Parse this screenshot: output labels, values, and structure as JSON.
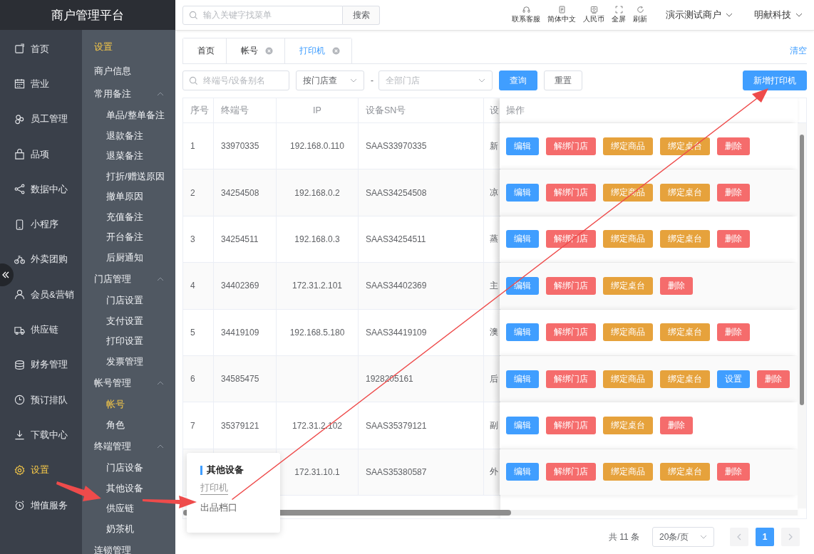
{
  "app_title": "商户管理平台",
  "nav": [
    {
      "label": "首页",
      "selected": false
    },
    {
      "label": "营业",
      "selected": false
    },
    {
      "label": "员工管理",
      "selected": false
    },
    {
      "label": "品项",
      "selected": false
    },
    {
      "label": "数据中心",
      "selected": false
    },
    {
      "label": "小程序",
      "selected": false
    },
    {
      "label": "外卖团购",
      "selected": false
    },
    {
      "label": "会员&营销",
      "selected": false
    },
    {
      "label": "供应链",
      "selected": false
    },
    {
      "label": "财务管理",
      "selected": false
    },
    {
      "label": "预订排队",
      "selected": false
    },
    {
      "label": "下载中心",
      "selected": false
    },
    {
      "label": "设置",
      "selected": true
    },
    {
      "label": "增值服务",
      "selected": false
    }
  ],
  "submenu": {
    "title": "设置",
    "items": [
      {
        "kind": "link",
        "label": "商户信息",
        "selected": false
      },
      {
        "kind": "group",
        "label": "常用备注",
        "expanded": true,
        "children": [
          {
            "label": "单品/整单备注",
            "selected": false
          },
          {
            "label": "退款备注",
            "selected": false
          },
          {
            "label": "退菜备注",
            "selected": false
          },
          {
            "label": "打折/赠送原因",
            "selected": false
          },
          {
            "label": "撤单原因",
            "selected": false
          },
          {
            "label": "充值备注",
            "selected": false
          },
          {
            "label": "开台备注",
            "selected": false
          },
          {
            "label": "后厨通知",
            "selected": false
          }
        ]
      },
      {
        "kind": "group",
        "label": "门店管理",
        "expanded": true,
        "children": [
          {
            "label": "门店设置",
            "selected": false
          },
          {
            "label": "支付设置",
            "selected": false
          },
          {
            "label": "打印设置",
            "selected": false
          },
          {
            "label": "发票管理",
            "selected": false
          }
        ]
      },
      {
        "kind": "group",
        "label": "帐号管理",
        "expanded": true,
        "children": [
          {
            "label": "帐号",
            "selected": true
          },
          {
            "label": "角色",
            "selected": false
          }
        ]
      },
      {
        "kind": "group",
        "label": "终端管理",
        "expanded": true,
        "children": [
          {
            "label": "门店设备",
            "selected": false
          },
          {
            "label": "其他设备",
            "selected": false
          },
          {
            "label": "供应链",
            "selected": false
          },
          {
            "label": "奶茶机",
            "selected": false
          }
        ]
      },
      {
        "kind": "group",
        "label": "连锁管理",
        "expanded": false
      }
    ]
  },
  "header": {
    "search": {
      "placeholder": "输入关键字找菜单",
      "button": "搜索"
    },
    "tools": [
      "联系客服",
      "简体中文",
      "人民币",
      "全屏",
      "刷新"
    ],
    "menus": [
      "演示测试商户",
      "明献科技"
    ]
  },
  "tabs": [
    {
      "label": "首页",
      "closable": false,
      "selected": false
    },
    {
      "label": "帐号",
      "closable": true,
      "selected": false
    },
    {
      "label": "打印机",
      "closable": true,
      "selected": true
    }
  ],
  "clear_link": "清空",
  "filters": {
    "search": {
      "placeholder": "终端号/设备别名"
    },
    "mode": {
      "value": "按门店查"
    },
    "separator": "-",
    "store": {
      "placeholder": "全部门店"
    },
    "query": "查询",
    "reset": "重置",
    "add": "新增打印机"
  },
  "table": {
    "columns": [
      "序号",
      "终端号",
      "IP",
      "设备SN号",
      "设",
      "操作"
    ],
    "rows": [
      {
        "index": "1",
        "terminal": "33970335",
        "ip": "192.168.0.110",
        "sn": "SAAS33970335",
        "column_5": "新",
        "actions": [
          {
            "label": "编辑",
            "kind": "primary"
          },
          {
            "label": "解绑门店",
            "kind": "danger"
          },
          {
            "label": "绑定商品",
            "kind": "warning"
          },
          {
            "label": "绑定桌台",
            "kind": "warning"
          },
          {
            "label": "删除",
            "kind": "danger"
          }
        ]
      },
      {
        "index": "2",
        "terminal": "34254508",
        "ip": "192.168.0.2",
        "sn": "SAAS34254508",
        "column_5": "凉",
        "actions": [
          {
            "label": "编辑",
            "kind": "primary"
          },
          {
            "label": "解绑门店",
            "kind": "danger"
          },
          {
            "label": "绑定商品",
            "kind": "warning"
          },
          {
            "label": "绑定桌台",
            "kind": "warning"
          },
          {
            "label": "删除",
            "kind": "danger"
          }
        ]
      },
      {
        "index": "3",
        "terminal": "34254511",
        "ip": "192.168.0.3",
        "sn": "SAAS34254511",
        "column_5": "蒸",
        "actions": [
          {
            "label": "编辑",
            "kind": "primary"
          },
          {
            "label": "解绑门店",
            "kind": "danger"
          },
          {
            "label": "绑定商品",
            "kind": "warning"
          },
          {
            "label": "绑定桌台",
            "kind": "warning"
          },
          {
            "label": "删除",
            "kind": "danger"
          }
        ]
      },
      {
        "index": "4",
        "terminal": "34402369",
        "ip": "172.31.2.101",
        "sn": "SAAS34402369",
        "column_5": "主",
        "actions": [
          {
            "label": "编辑",
            "kind": "primary"
          },
          {
            "label": "解绑门店",
            "kind": "danger"
          },
          {
            "label": "绑定桌台",
            "kind": "warning"
          },
          {
            "label": "删除",
            "kind": "danger"
          }
        ]
      },
      {
        "index": "5",
        "terminal": "34419109",
        "ip": "192.168.5.180",
        "sn": "SAAS34419109",
        "column_5": "澳",
        "actions": [
          {
            "label": "编辑",
            "kind": "primary"
          },
          {
            "label": "解绑门店",
            "kind": "danger"
          },
          {
            "label": "绑定商品",
            "kind": "warning"
          },
          {
            "label": "绑定桌台",
            "kind": "warning"
          },
          {
            "label": "删除",
            "kind": "danger"
          }
        ]
      },
      {
        "index": "6",
        "terminal": "34585475",
        "sn": "1928205161",
        "column_5": "后",
        "actions": [
          {
            "label": "编辑",
            "kind": "primary"
          },
          {
            "label": "解绑门店",
            "kind": "danger"
          },
          {
            "label": "绑定商品",
            "kind": "warning"
          },
          {
            "label": "绑定桌台",
            "kind": "warning"
          },
          {
            "label": "设置",
            "kind": "primary"
          },
          {
            "label": "删除",
            "kind": "danger"
          }
        ]
      },
      {
        "index": "7",
        "terminal": "35379121",
        "ip": "172.31.2.102",
        "sn": "SAAS35379121",
        "column_5": "副",
        "actions": [
          {
            "label": "编辑",
            "kind": "primary"
          },
          {
            "label": "解绑门店",
            "kind": "danger"
          },
          {
            "label": "绑定桌台",
            "kind": "warning"
          },
          {
            "label": "删除",
            "kind": "danger"
          }
        ]
      },
      {
        "ip": "172.31.10.1",
        "sn": "SAAS35380587",
        "column_5": "外",
        "actions": [
          {
            "label": "编辑",
            "kind": "primary"
          },
          {
            "label": "解绑门店",
            "kind": "danger"
          },
          {
            "label": "绑定商品",
            "kind": "warning"
          },
          {
            "label": "绑定桌台",
            "kind": "warning"
          },
          {
            "label": "删除",
            "kind": "danger"
          }
        ]
      }
    ]
  },
  "pagination": {
    "total": "共 11 条",
    "page_size": "20条/页",
    "pages": [
      {
        "label": "1",
        "selected": true
      }
    ]
  },
  "popup": {
    "title": "其他设备",
    "items": [
      {
        "label": "打印机",
        "selected": true
      },
      {
        "label": "出品档口",
        "selected": false
      }
    ]
  }
}
